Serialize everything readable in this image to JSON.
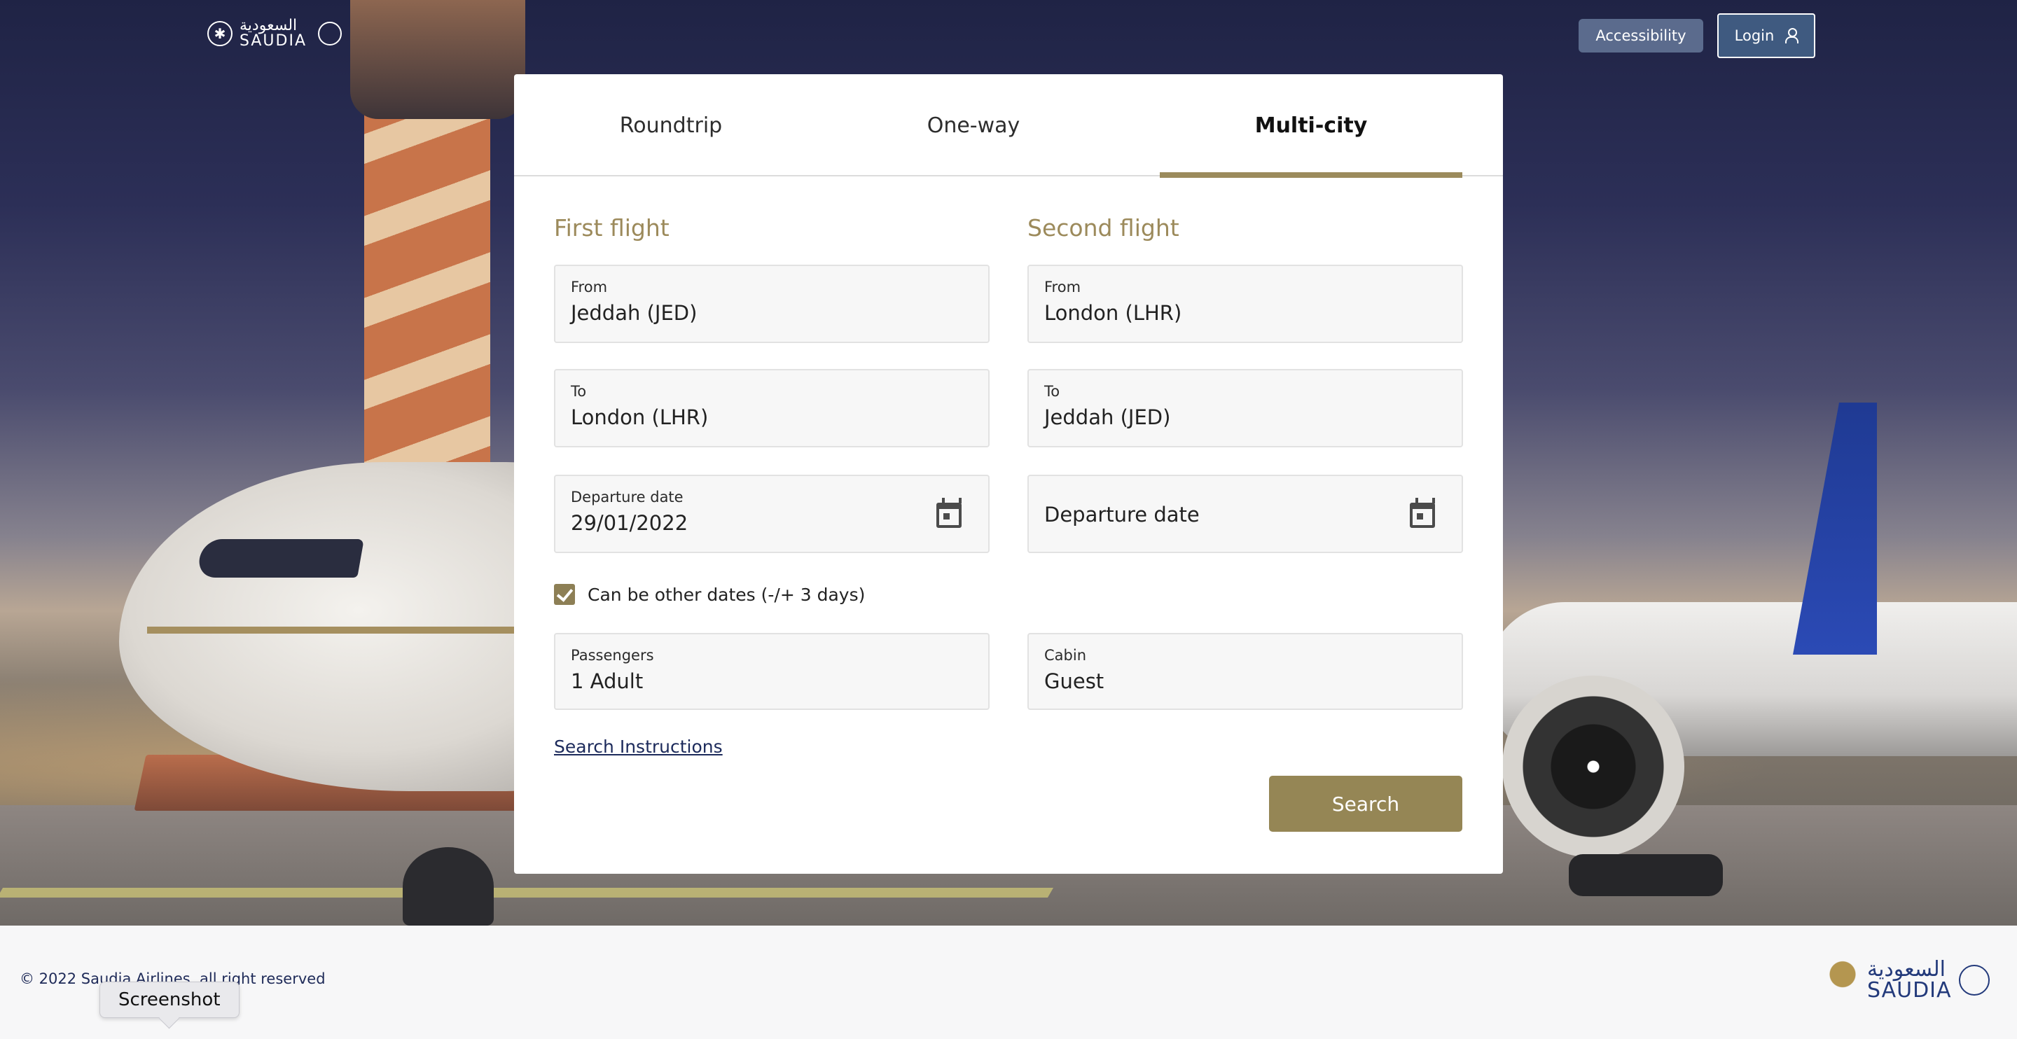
{
  "header": {
    "logo": {
      "arabic": "السعودية",
      "english": "SAUDIA"
    },
    "accessibility_label": "Accessibility",
    "login_label": "Login"
  },
  "tabs": [
    {
      "label": "Roundtrip",
      "active": false
    },
    {
      "label": "One-way",
      "active": false
    },
    {
      "label": "Multi-city",
      "active": true
    }
  ],
  "first_flight": {
    "title": "First flight",
    "from": {
      "label": "From",
      "value": "Jeddah (JED)"
    },
    "to": {
      "label": "To",
      "value": "London (LHR)"
    },
    "departure": {
      "label": "Departure date",
      "value": "29/01/2022"
    }
  },
  "second_flight": {
    "title": "Second flight",
    "from": {
      "label": "From",
      "value": "London (LHR)"
    },
    "to": {
      "label": "To",
      "value": "Jeddah (JED)"
    },
    "departure": {
      "placeholder": "Departure date"
    }
  },
  "flexible_dates": {
    "label": "Can be other dates (-/+ 3 days)",
    "checked": true
  },
  "passengers": {
    "label": "Passengers",
    "value": "1 Adult"
  },
  "cabin": {
    "label": "Cabin",
    "value": "Guest"
  },
  "search_instructions": "Search Instructions",
  "search_button": "Search",
  "footer": {
    "copyright": "© 2022 Saudia Airlines, all right reserved",
    "logo": {
      "arabic": "السعودية",
      "english": "SAUDIA"
    }
  },
  "tooltip": "Screenshot",
  "colors": {
    "accent": "#9b8b5c",
    "button": "#958655",
    "login_bg": "#3f5a80",
    "accessibility_bg": "#5b6b8d"
  }
}
